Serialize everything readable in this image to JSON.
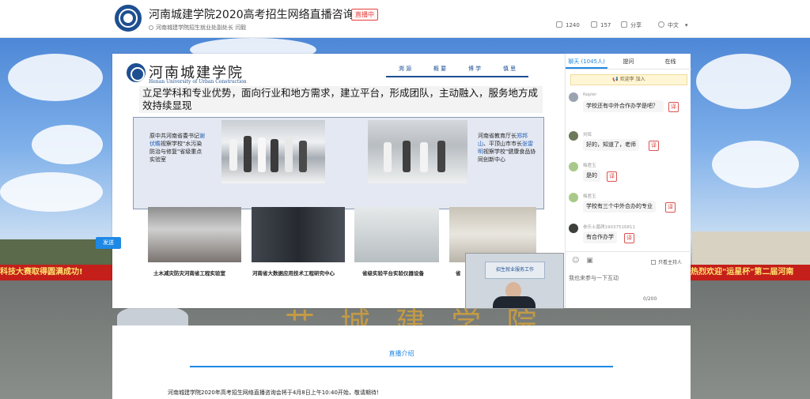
{
  "header": {
    "title": "河南城建学院2020高考招生网络直播咨询会",
    "live_badge": "直播中",
    "org": "河南城建学院招生就业处副处长 闫毅",
    "likes": "1240",
    "comments": "157",
    "share": "分享",
    "language": "中文"
  },
  "background": {
    "banner_left": "科技大赛取得圆满成功!",
    "banner_right": "热烈欢迎\"运星杯\"第二届河南"
  },
  "slide": {
    "logo_cn": "河南城建学院",
    "logo_en": "Henan University of Urban Construction",
    "nav": [
      "溯 源",
      "概 要",
      "博 学",
      "慎 思"
    ],
    "heading": "立足学科和专业优势，面向行业和地方需求，建立平台，形成团队，主动融入，服务地方成效持续显现",
    "left_caption_1": "原中共河南省委书记",
    "left_caption_name": "谢伏瞻",
    "left_caption_2": "视察学校\"水污染防治与修复\"省级重点实验室",
    "right_caption_1": "河南省教育厅长",
    "right_caption_name1": "郑邦山",
    "right_caption_2": "、平顶山市市长",
    "right_caption_name2": "张雷明",
    "right_caption_3": "视察学校\"健康食品协同创新中心",
    "bottom_captions": [
      "土木减灾防灾河南省工程实验室",
      "河南省大数据应用技术工程研究中心",
      "省级实验平台实验仪器设备",
      "省"
    ]
  },
  "chat": {
    "tabs": [
      "聊天 (1045人)",
      "提问",
      "在线"
    ],
    "welcome": "欢迎李 加入",
    "messages": [
      {
        "user": "Kepler",
        "text": "学校还有中外合作办学是吧？"
      },
      {
        "user": "刘辉",
        "text": "好的，知道了，老师"
      },
      {
        "user": "梅君玉",
        "text": "是的"
      },
      {
        "user": "梅君玉",
        "text": "学校有三个中外合办的专业"
      },
      {
        "user": "参乐士墓碑19037516811",
        "text": "有合作办学"
      }
    ],
    "translate_icon": "译",
    "host_only": "只看主持人",
    "input_placeholder": "我也来参与一下互动",
    "counter": "0/200",
    "send_label": "发送"
  },
  "intro": {
    "tab_label": "直播介绍",
    "text": "河南城建学院2020年高考招生网络直播咨询会将于4月8日上午10:40开始，敬请期待！"
  },
  "presenter_video": {
    "board_text": "招生就业服务工作"
  },
  "colors": {
    "accent": "#1e88e5",
    "live_red": "#e64340",
    "brand_blue": "#1d4f91"
  },
  "icons": [
    "logo-icon",
    "location-icon",
    "like-icon",
    "comment-icon",
    "share-icon",
    "chevron-down-icon",
    "avatar",
    "translate-icon",
    "emoji-icon",
    "image-icon"
  ]
}
